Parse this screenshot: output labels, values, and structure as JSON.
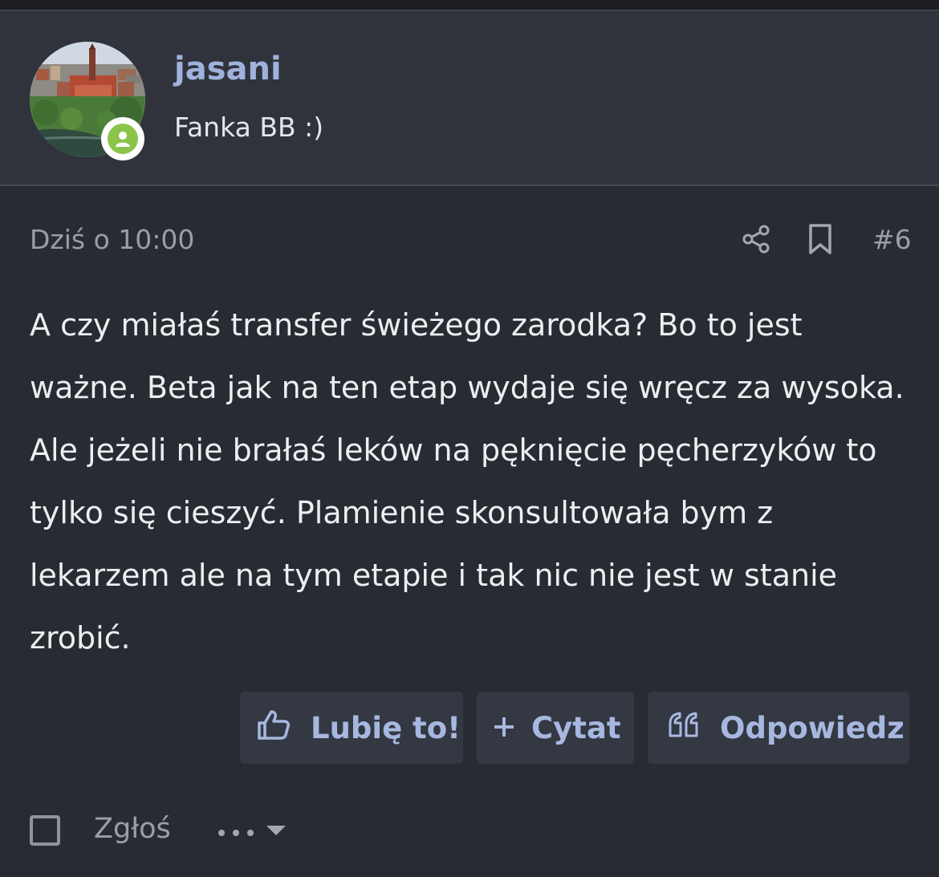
{
  "author": {
    "username": "jasani",
    "title": "Fanka BB :)",
    "status": "online",
    "status_color": "#8ac54a",
    "username_color": "#9fb2dc"
  },
  "post": {
    "date": "Dziś o 10:00",
    "number": "#6",
    "body": "A czy miałaś transfer świeżego zarodka? Bo to jest ważne. Beta jak na ten etap wydaje się wręcz za wysoka. Ale jeżeli nie brałaś leków na pęknięcie pęcherzyków to tylko się cieszyć. Plamienie skonsultowała bym z lekarzem ale na tym etapie i tak nic nie jest w stanie zrobić."
  },
  "actions": {
    "like_label": "Lubię to!",
    "quote_label": "Cytat",
    "reply_label": "Odpowiedz",
    "report_label": "Zgłoś"
  },
  "icons": {
    "share": "share-icon",
    "bookmark": "bookmark-icon",
    "like": "thumbs-up-icon",
    "quote": "plus-icon",
    "reply": "quote-marks-icon",
    "more": "more-dots-icon"
  },
  "colors": {
    "background": "#292b33",
    "panel": "#30333c",
    "button": "#343843",
    "accent": "#a7b8e0"
  }
}
